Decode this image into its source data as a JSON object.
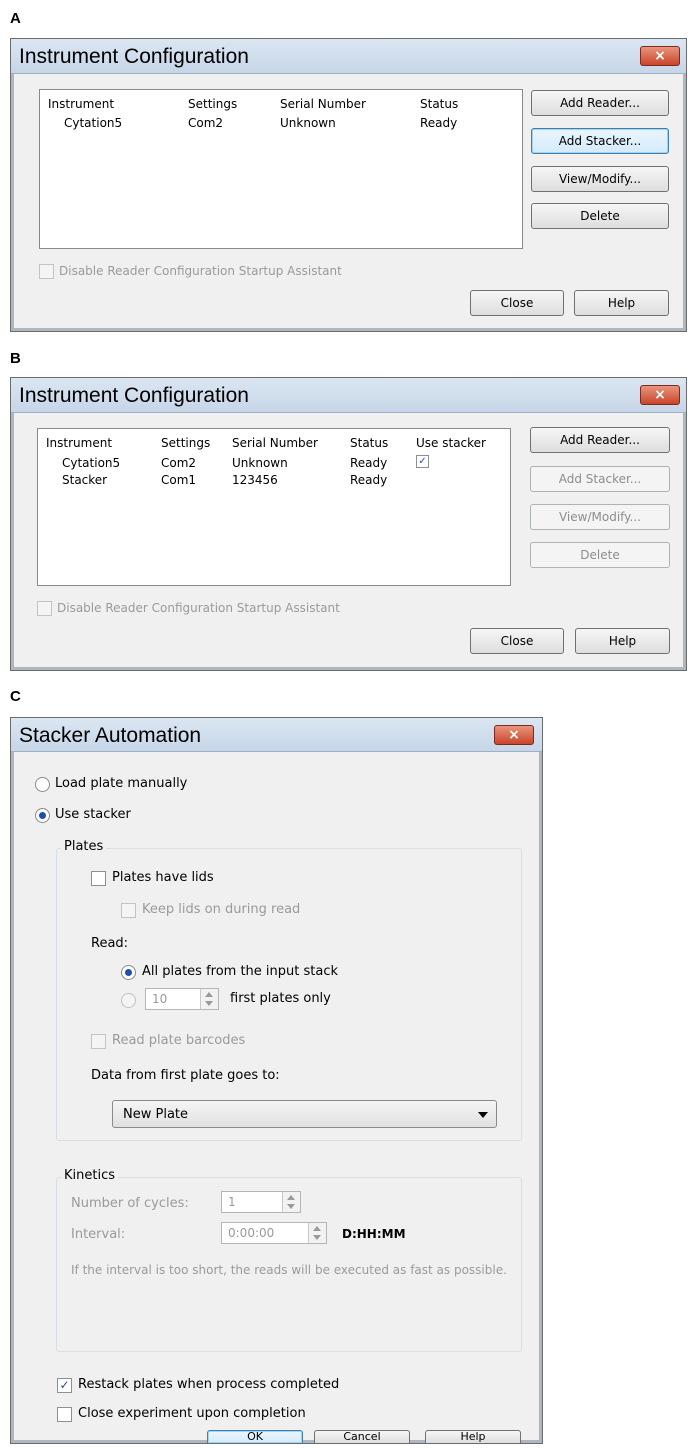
{
  "panels": {
    "a": {
      "letter": "A"
    },
    "b": {
      "letter": "B"
    },
    "c": {
      "letter": "C"
    }
  },
  "instrument_config_a": {
    "title": "Instrument Configuration",
    "close_glyph": "×",
    "columns": [
      "Instrument",
      "Settings",
      "Serial Number",
      "Status"
    ],
    "rows": [
      {
        "instrument": "Cytation5",
        "settings": "Com2",
        "serial": "Unknown",
        "status": "Ready"
      }
    ],
    "buttons": {
      "add_reader": "Add Reader...",
      "add_stacker": "Add Stacker...",
      "view_modify": "View/Modify...",
      "delete": "Delete",
      "close": "Close",
      "help": "Help"
    },
    "disable_assistant_label": "Disable Reader Configuration Startup Assistant"
  },
  "instrument_config_b": {
    "title": "Instrument Configuration",
    "close_glyph": "×",
    "columns": [
      "Instrument",
      "Settings",
      "Serial Number",
      "Status",
      "Use stacker"
    ],
    "rows": [
      {
        "instrument": "Cytation5",
        "settings": "Com2",
        "serial": "Unknown",
        "status": "Ready",
        "use_stacker": true
      },
      {
        "instrument": "Stacker",
        "settings": "Com1",
        "serial": "123456",
        "status": "Ready"
      }
    ],
    "buttons": {
      "add_reader": "Add Reader...",
      "add_stacker": "Add Stacker...",
      "view_modify": "View/Modify...",
      "delete": "Delete",
      "close": "Close",
      "help": "Help"
    },
    "disable_assistant_label": "Disable Reader Configuration Startup Assistant"
  },
  "stacker_automation": {
    "title": "Stacker Automation",
    "close_glyph": "×",
    "load_manually_label": "Load plate manually",
    "use_stacker_label": "Use stacker",
    "plates_group": {
      "title": "Plates",
      "have_lids_label": "Plates have lids",
      "keep_lids_label": "Keep lids on during read",
      "read_label": "Read:",
      "all_plates_label": "All plates from the input stack",
      "first_plates_value": "10",
      "first_plates_label": "first plates only",
      "barcodes_label": "Read plate barcodes",
      "data_goes_to_label": "Data from first plate goes to:",
      "data_destination": "New Plate"
    },
    "kinetics_group": {
      "title": "Kinetics",
      "cycles_label": "Number of cycles:",
      "cycles_value": "1",
      "interval_label": "Interval:",
      "interval_value": "0:00:00",
      "interval_format": "D:HH:MM",
      "note": "If the interval is too short, the reads will be executed as fast as possible."
    },
    "restack_label": "Restack plates when process completed",
    "restack_checked": true,
    "close_experiment_label": "Close experiment upon completion",
    "buttons": {
      "ok": "OK",
      "cancel": "Cancel",
      "help": "Help"
    },
    "check_glyph": "✓"
  }
}
